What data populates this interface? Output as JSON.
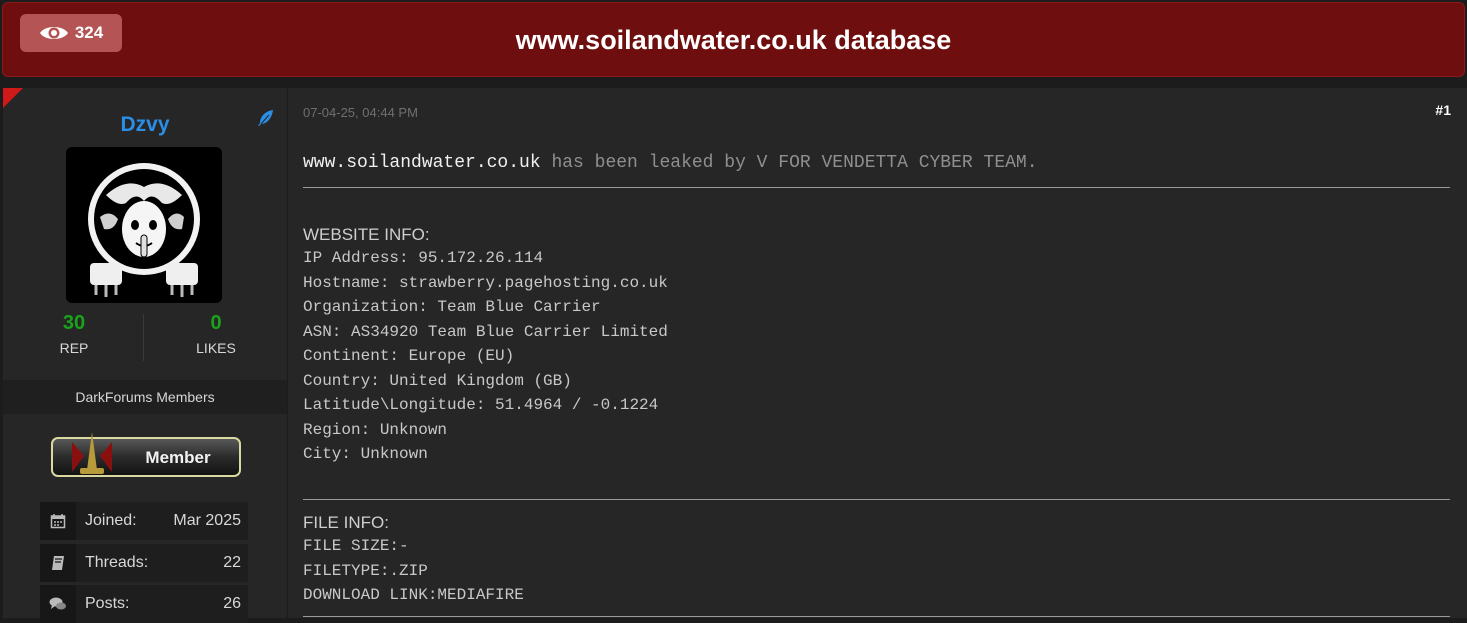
{
  "header": {
    "views": "324",
    "title": "www.soilandwater.co.uk database"
  },
  "user": {
    "name": "Dzvy",
    "rep_value": "30",
    "rep_label": "REP",
    "likes_value": "0",
    "likes_label": "LIKES",
    "group": "DarkForums Members",
    "badge_text": "Member",
    "info": [
      {
        "label": "Joined:",
        "value": "Mar 2025",
        "icon": "calendar-icon"
      },
      {
        "label": "Threads:",
        "value": "22",
        "icon": "book-icon"
      },
      {
        "label": "Posts:",
        "value": "26",
        "icon": "comments-icon"
      }
    ]
  },
  "post": {
    "date": "07-04-25, 04:44 PM",
    "number": "#1",
    "intro_site": "www.soilandwater.co.uk",
    "intro_rest": " has been leaked by V FOR VENDETTA CYBER TEAM.",
    "website_title": "WEBSITE INFO:",
    "website_lines": [
      "IP Address: 95.172.26.114",
      "Hostname: strawberry.pagehosting.co.uk",
      "Organization: Team Blue Carrier",
      "ASN: AS34920 Team Blue Carrier Limited",
      "Continent: Europe (EU)",
      "Country: United Kingdom (GB)",
      "Latitude\\Longitude: 51.4964 / -0.1224",
      "Region: Unknown",
      "City: Unknown"
    ],
    "file_title": "FILE INFO:",
    "file_lines": [
      "FILE SIZE:-",
      "FILETYPE:.ZIP",
      "DOWNLOAD LINK:MEDIAFIRE"
    ]
  },
  "colors": {
    "header_bg": "#6e0e0e",
    "username": "#2a8ee6",
    "rep_green": "#1aa31a"
  }
}
